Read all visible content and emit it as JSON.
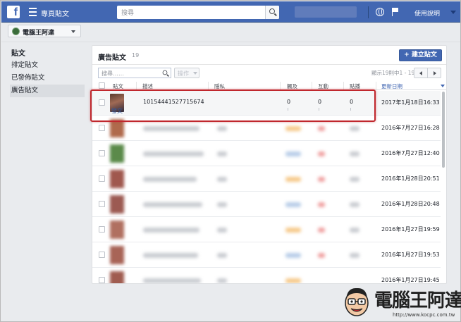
{
  "topbar": {
    "logo_letter": "f",
    "title": "專頁貼文",
    "search_placeholder": "搜尋",
    "help_link": "使用說明"
  },
  "page_selector": {
    "page_name": "電腦王阿達"
  },
  "sidebar": {
    "heading": "貼文",
    "items": [
      {
        "label": "排定貼文",
        "active": false
      },
      {
        "label": "已發佈貼文",
        "active": false
      },
      {
        "label": "廣告貼文",
        "active": true
      }
    ]
  },
  "panel": {
    "title": "廣告貼文",
    "count": "19",
    "create_button": "+ 建立貼文",
    "search_placeholder": "搜尋……",
    "actions_button": "操作",
    "pager_text": "顯示19則中1 - 19"
  },
  "table": {
    "columns": [
      "貼文",
      "描述",
      "隱私",
      "觸及",
      "互動",
      "點播",
      "更新日期"
    ],
    "rows": [
      {
        "thumb_label": "發文",
        "description": "10154441527715674",
        "reach": "0",
        "engagement": "0",
        "clicks": "0",
        "updated": "2017年1月18日16:33"
      },
      {
        "updated": "2016年7月27日16:28"
      },
      {
        "updated": "2016年7月27日12:40"
      },
      {
        "updated": "2016年1月28日20:51"
      },
      {
        "updated": "2016年1月28日20:48"
      },
      {
        "updated": "2016年1月27日19:59"
      },
      {
        "updated": "2016年1月27日19:53"
      },
      {
        "updated": "2016年1月27日19:45"
      }
    ]
  },
  "watermark": {
    "title": "電腦王阿達",
    "url": "http://www.kocpc.com.tw"
  },
  "colors": {
    "brand": "#4267b2",
    "highlight": "#c0272d"
  }
}
